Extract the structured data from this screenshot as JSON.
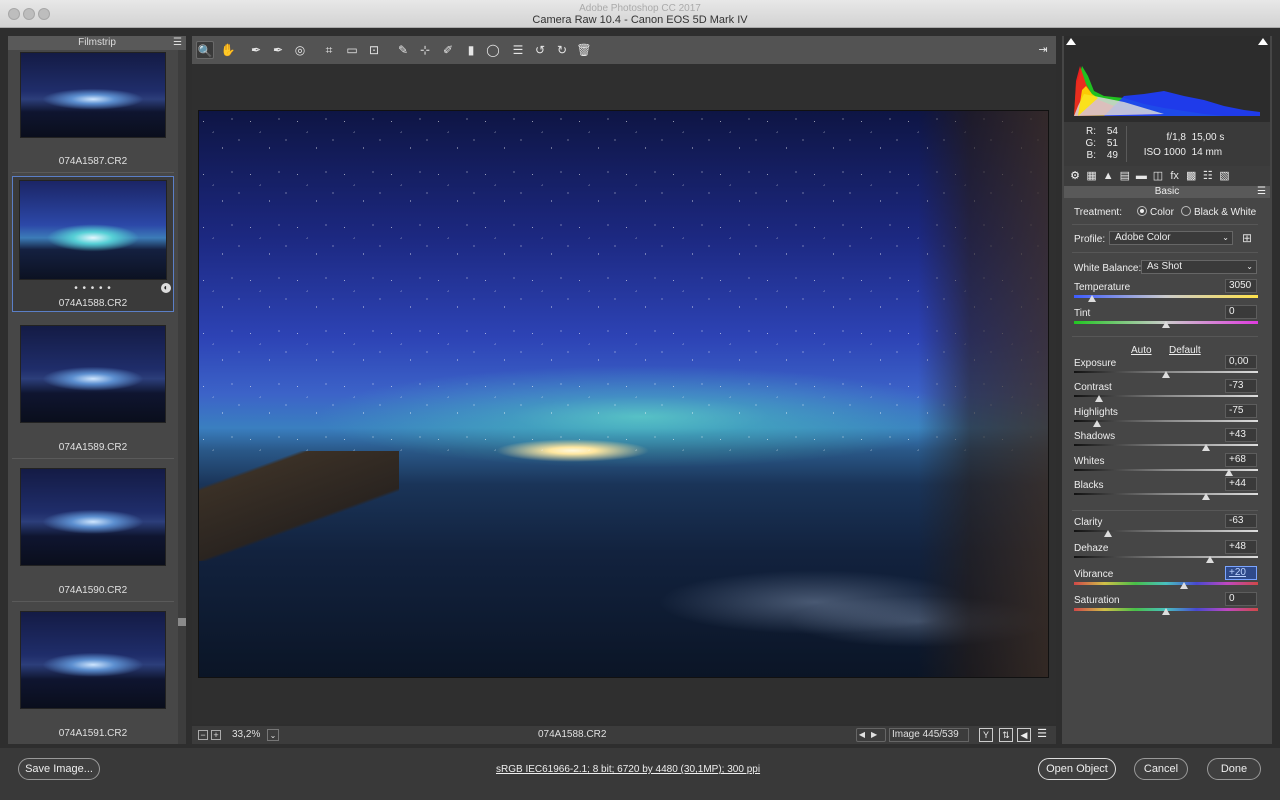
{
  "window": {
    "ghost_title": "Adobe Photoshop CC 2017",
    "title": "Camera Raw 10.4  -  Canon EOS 5D Mark IV"
  },
  "filmstrip": {
    "header": "Filmstrip",
    "menu_icon": "hamburger-icon",
    "items": [
      {
        "name": "074A1587.CR2",
        "selected": false
      },
      {
        "name": "074A1588.CR2",
        "selected": true,
        "rating": "• • • • •"
      },
      {
        "name": "074A1589.CR2",
        "selected": false
      },
      {
        "name": "074A1590.CR2",
        "selected": false
      },
      {
        "name": "074A1591.CR2",
        "selected": false
      }
    ]
  },
  "toolbar": {
    "tools": [
      {
        "icon": "zoom-tool-icon",
        "glyph": "🔍",
        "active": true
      },
      {
        "icon": "hand-tool-icon",
        "glyph": "✋"
      },
      {
        "icon": "white-balance-tool-icon",
        "glyph": "✒"
      },
      {
        "icon": "color-sampler-tool-icon",
        "glyph": "✒"
      },
      {
        "icon": "targeted-adjustment-tool-icon",
        "glyph": "◎"
      },
      {
        "icon": "crop-tool-icon",
        "glyph": "⌗"
      },
      {
        "icon": "straighten-tool-icon",
        "glyph": "▭"
      },
      {
        "icon": "transform-tool-icon",
        "glyph": "⊡"
      },
      {
        "icon": "spot-removal-tool-icon",
        "glyph": "✎"
      },
      {
        "icon": "red-eye-tool-icon",
        "glyph": "⊹"
      },
      {
        "icon": "adjustment-brush-icon",
        "glyph": "✐"
      },
      {
        "icon": "graduated-filter-icon",
        "glyph": "▮"
      },
      {
        "icon": "radial-filter-icon",
        "glyph": "◯"
      },
      {
        "icon": "preferences-icon",
        "glyph": "☰"
      },
      {
        "icon": "rotate-left-icon",
        "glyph": "↺"
      },
      {
        "icon": "rotate-right-icon",
        "glyph": "↻"
      },
      {
        "icon": "trash-icon",
        "glyph": "🗑"
      }
    ],
    "fullscreen_icon": "toggle-fullscreen-icon"
  },
  "status": {
    "zoom": "33,2%",
    "filename": "074A1588.CR2",
    "image_count": "Image 445/539"
  },
  "info": {
    "r_label": "R:",
    "r": "54",
    "g_label": "G:",
    "g": "51",
    "b_label": "B:",
    "b": "49",
    "aperture": "f/1,8",
    "shutter": "15,00 s",
    "iso": "ISO 1000",
    "focal": "14 mm"
  },
  "panel_tabs": [
    {
      "icon": "basic-panel-icon",
      "glyph": "⚙"
    },
    {
      "icon": "tone-curve-icon",
      "glyph": "▦"
    },
    {
      "icon": "detail-icon",
      "glyph": "▲"
    },
    {
      "icon": "hsl-icon",
      "glyph": "▤"
    },
    {
      "icon": "split-toning-icon",
      "glyph": "▬"
    },
    {
      "icon": "lens-corrections-icon",
      "glyph": "◫"
    },
    {
      "icon": "effects-icon",
      "glyph": "fx"
    },
    {
      "icon": "camera-calibration-icon",
      "glyph": "▩"
    },
    {
      "icon": "presets-icon",
      "glyph": "☷"
    },
    {
      "icon": "snapshots-icon",
      "glyph": "▧"
    }
  ],
  "basic": {
    "header": "Basic",
    "treatment_label": "Treatment:",
    "color_label": "Color",
    "bw_label": "Black & White",
    "profile_label": "Profile:",
    "profile_value": "Adobe Color",
    "wb_label": "White Balance:",
    "wb_value": "As Shot",
    "auto": "Auto",
    "default": "Default",
    "sliders": [
      {
        "label": "Temperature",
        "value": "3050",
        "pos": 0.1
      },
      {
        "label": "Tint",
        "value": "0",
        "pos": 0.5
      },
      {
        "label": "Exposure",
        "value": "0,00",
        "pos": 0.5
      },
      {
        "label": "Contrast",
        "value": "-73",
        "pos": 0.135
      },
      {
        "label": "Highlights",
        "value": "-75",
        "pos": 0.125
      },
      {
        "label": "Shadows",
        "value": "+43",
        "pos": 0.715
      },
      {
        "label": "Whites",
        "value": "+68",
        "pos": 0.84
      },
      {
        "label": "Blacks",
        "value": "+44",
        "pos": 0.72
      },
      {
        "label": "Clarity",
        "value": "-63",
        "pos": 0.185
      },
      {
        "label": "Dehaze",
        "value": "+48",
        "pos": 0.74
      },
      {
        "label": "Vibrance",
        "value": "+20",
        "pos": 0.6
      },
      {
        "label": "Saturation",
        "value": "0",
        "pos": 0.5
      }
    ]
  },
  "footer": {
    "save": "Save Image...",
    "workflow": "sRGB IEC61966-2.1; 8 bit; 6720 by 4480 (30,1MP); 300 ppi",
    "open": "Open Object",
    "cancel": "Cancel",
    "done": "Done"
  },
  "colors": {
    "accent": "#5b7fc7",
    "panel": "#464646",
    "highlight_field": "#2f4a8a"
  }
}
